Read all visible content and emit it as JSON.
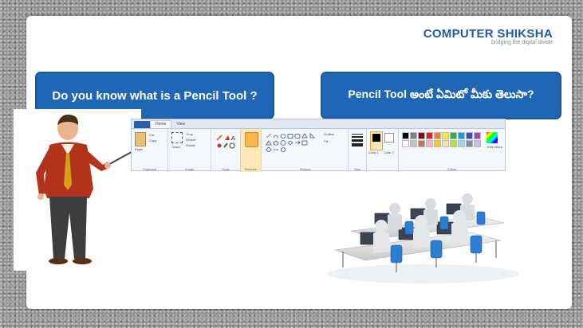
{
  "brand": {
    "name": "COMPUTER SHIKSHA",
    "tagline": "bridging the digital divide"
  },
  "banner_left": {
    "text": "Do you know what is a Pencil Tool ?"
  },
  "banner_right": {
    "text": "Pencil Tool అంటే ఏమిటో మీకు తెలుసా?"
  },
  "ribbon": {
    "tabs": [
      "Home",
      "View"
    ],
    "groups": [
      "Clipboard",
      "Image",
      "Tools",
      "Brushes",
      "Shapes",
      "Size",
      "Colors"
    ],
    "labels": {
      "paste": "Paste",
      "cut": "Cut",
      "copy": "Copy",
      "select": "Select",
      "crop": "Crop",
      "resize": "Resize",
      "rotate": "Rotate",
      "outline": "Outline",
      "fill": "Fill",
      "color1": "Color 1",
      "color2": "Color 2",
      "edit_colors": "Edit colors"
    }
  },
  "palette": [
    "#000000",
    "#7f7f7f",
    "#880015",
    "#ed1c24",
    "#ff7f27",
    "#fff200",
    "#22b14c",
    "#00a2e8",
    "#3f48cc",
    "#a349a4",
    "#ffffff",
    "#c3c3c3",
    "#b97a57",
    "#ffaec9",
    "#ffc90e",
    "#efe4b0",
    "#b5e61d",
    "#99d9ea",
    "#7092be",
    "#c8bfe7"
  ]
}
